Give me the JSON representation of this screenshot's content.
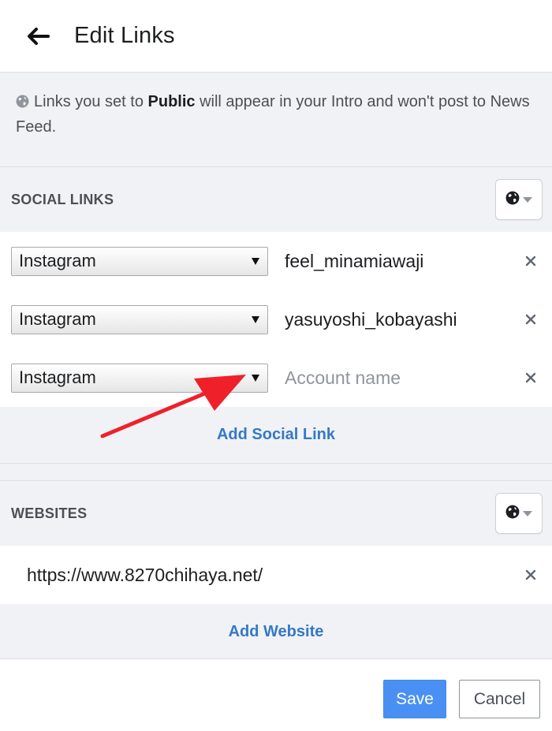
{
  "header": {
    "title": "Edit Links"
  },
  "info": {
    "text_before": "Links you set to ",
    "text_bold": "Public",
    "text_after": " will appear in your Intro and won't post to News Feed."
  },
  "social": {
    "title": "SOCIAL LINKS",
    "rows": [
      {
        "platform": "Instagram",
        "account": "feel_minamiawaji"
      },
      {
        "platform": "Instagram",
        "account": "yasuyoshi_kobayashi"
      }
    ],
    "new_row": {
      "platform": "Instagram",
      "placeholder": "Account name"
    },
    "add_label": "Add Social Link"
  },
  "websites": {
    "title": "WEBSITES",
    "rows": [
      {
        "url": "https://www.8270chihaya.net/"
      }
    ],
    "add_label": "Add Website"
  },
  "footer": {
    "save_label": "Save",
    "cancel_label": "Cancel"
  },
  "colors": {
    "accent": "#4a90f2",
    "link": "#3578c6",
    "annotation": "#f0202a",
    "panel": "#f1f2f5"
  }
}
